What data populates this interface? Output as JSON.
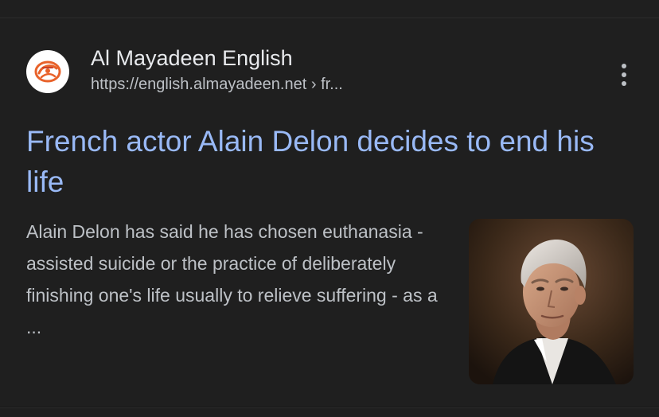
{
  "result": {
    "site_name": "Al Mayadeen English",
    "url": "https://english.almayadeen.net › fr...",
    "title": "French actor Alain Delon decides to end his life",
    "snippet": "Alain Delon has said he has chosen euthanasia - assisted suicide or the practice of deliberately finishing one's life usually to relieve suffering - as a ...",
    "favicon_icon": "al-mayadeen-logo-icon",
    "menu_icon": "more-vertical-icon",
    "thumbnail": "portrait-photo"
  },
  "colors": {
    "background": "#171717",
    "card": "#1f1f1f",
    "title_link": "#99b9f6",
    "primary_text": "#e8eaed",
    "secondary_text": "#bdc1c6",
    "logo_orange": "#e8622a"
  }
}
